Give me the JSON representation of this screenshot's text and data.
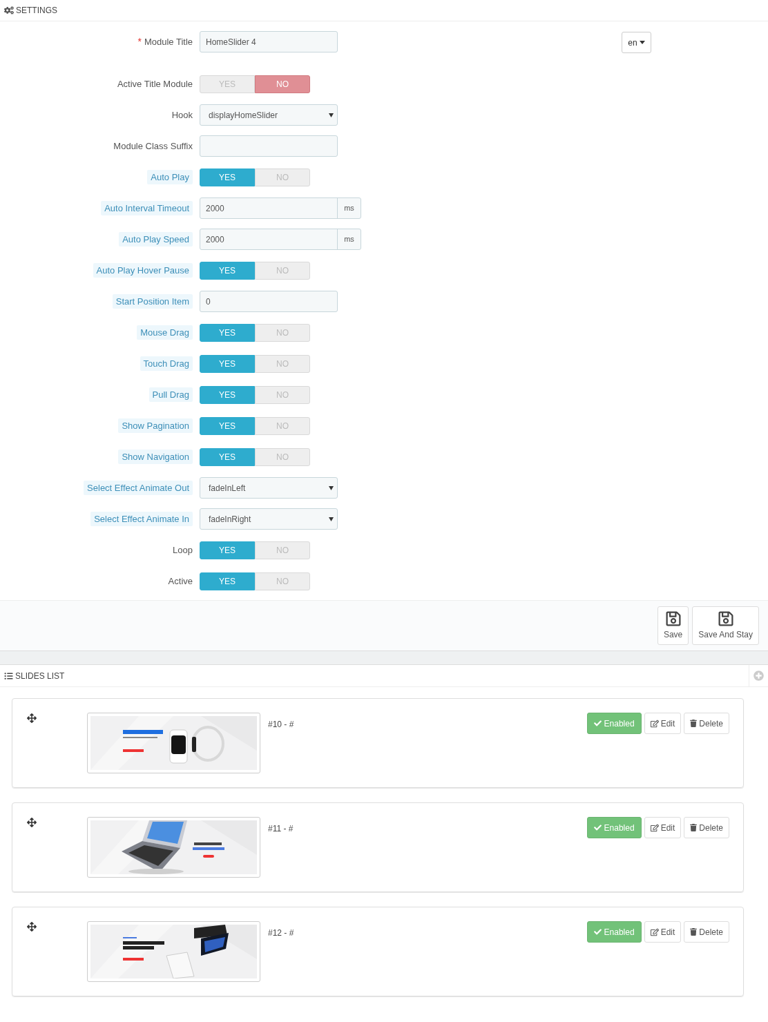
{
  "settings": {
    "title": "SETTINGS",
    "language": "en"
  },
  "fields": [
    {
      "kind": "text",
      "label": "Module Title",
      "marker": "*",
      "hint": false,
      "value": "HomeSlider 4"
    },
    {
      "kind": "switch",
      "label": "Active Title Module",
      "hint": false,
      "on": false,
      "yes": "YES",
      "no": "NO"
    },
    {
      "kind": "select",
      "label": "Hook",
      "hint": false,
      "value": "displayHomeSlider"
    },
    {
      "kind": "text",
      "label": "Module Class Suffix",
      "hint": false
    },
    {
      "kind": "switch",
      "label": "Auto Play",
      "hint": true,
      "on": true,
      "yes": "YES",
      "no": "NO"
    },
    {
      "kind": "addon",
      "label": "Auto Interval Timeout",
      "hint": true,
      "value": "2000",
      "unit": "ms"
    },
    {
      "kind": "addon",
      "label": "Auto Play Speed",
      "hint": true,
      "value": "2000",
      "unit": "ms"
    },
    {
      "kind": "switch",
      "label": "Auto Play Hover Pause",
      "hint": true,
      "on": true,
      "yes": "YES",
      "no": "NO"
    },
    {
      "kind": "text",
      "label": "Start Position Item",
      "hint": true,
      "value": "0"
    },
    {
      "kind": "switch",
      "label": "Mouse Drag",
      "hint": true,
      "on": true,
      "yes": "YES",
      "no": "NO"
    },
    {
      "kind": "switch",
      "label": "Touch Drag",
      "hint": true,
      "on": true,
      "yes": "YES",
      "no": "NO"
    },
    {
      "kind": "switch",
      "label": "Pull Drag",
      "hint": true,
      "on": true,
      "yes": "YES",
      "no": "NO"
    },
    {
      "kind": "switch",
      "label": "Show Pagination",
      "hint": true,
      "on": true,
      "yes": "YES",
      "no": "NO"
    },
    {
      "kind": "switch",
      "label": "Show Navigation",
      "hint": true,
      "on": true,
      "yes": "YES",
      "no": "NO"
    },
    {
      "kind": "select",
      "label": "Select Effect Animate Out",
      "hint": true,
      "value": "fadeInLeft"
    },
    {
      "kind": "select",
      "label": "Select Effect Animate In",
      "hint": true,
      "value": "fadeInRight"
    },
    {
      "kind": "switch",
      "label": "Loop",
      "hint": false,
      "on": true,
      "yes": "YES",
      "no": "NO"
    },
    {
      "kind": "switch",
      "label": "Active",
      "hint": false,
      "on": true,
      "yes": "YES",
      "no": "NO"
    }
  ],
  "footer_buttons": [
    {
      "label": "Save"
    },
    {
      "label": "Save And Stay"
    }
  ],
  "slides_list": {
    "title": "SLIDES LIST"
  },
  "slides": [
    {
      "image": {
        "kind": "picture"
      },
      "label": "#10 - #",
      "status": "Enabled",
      "enabled": true,
      "actions": [
        "Edit",
        "Delete"
      ]
    },
    {
      "image": {
        "kind": "picture"
      },
      "label": "#11 - #",
      "status": "Enabled",
      "enabled": true,
      "actions": [
        "Edit",
        "Delete"
      ]
    },
    {
      "image": {
        "kind": "picture"
      },
      "label": "#12 - #",
      "status": "Enabled",
      "enabled": true,
      "actions": [
        "Edit",
        "Delete"
      ]
    }
  ]
}
